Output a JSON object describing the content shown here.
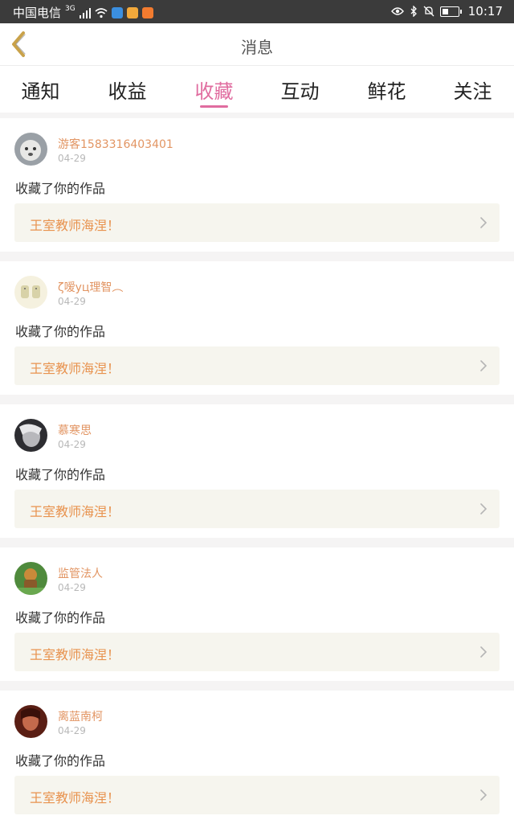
{
  "status_bar": {
    "carrier": "中国电信",
    "network": "3G",
    "time": "10:17"
  },
  "header": {
    "title": "消息"
  },
  "tabs": [
    {
      "label": "通知"
    },
    {
      "label": "收益"
    },
    {
      "label": "收藏",
      "active": true
    },
    {
      "label": "互动"
    },
    {
      "label": "鲜花"
    },
    {
      "label": "关注"
    }
  ],
  "accent_color": "#e06c9f",
  "name_color": "#e29563",
  "work_title_color": "#e8924e",
  "items": [
    {
      "user": "游客1583316403401",
      "date": "04-29",
      "action": "收藏了你的作品",
      "work": "王室教师海涅！"
    },
    {
      "user": "ζ嗳yц理智︵",
      "date": "04-29",
      "action": "收藏了你的作品",
      "work": "王室教师海涅！"
    },
    {
      "user": "慕寒思",
      "date": "04-29",
      "action": "收藏了你的作品",
      "work": "王室教师海涅！"
    },
    {
      "user": "监管法人",
      "date": "04-29",
      "action": "收藏了你的作品",
      "work": "王室教师海涅！"
    },
    {
      "user": "离蓝南柯",
      "date": "04-29",
      "action": "收藏了你的作品",
      "work": "王室教师海涅！"
    }
  ]
}
